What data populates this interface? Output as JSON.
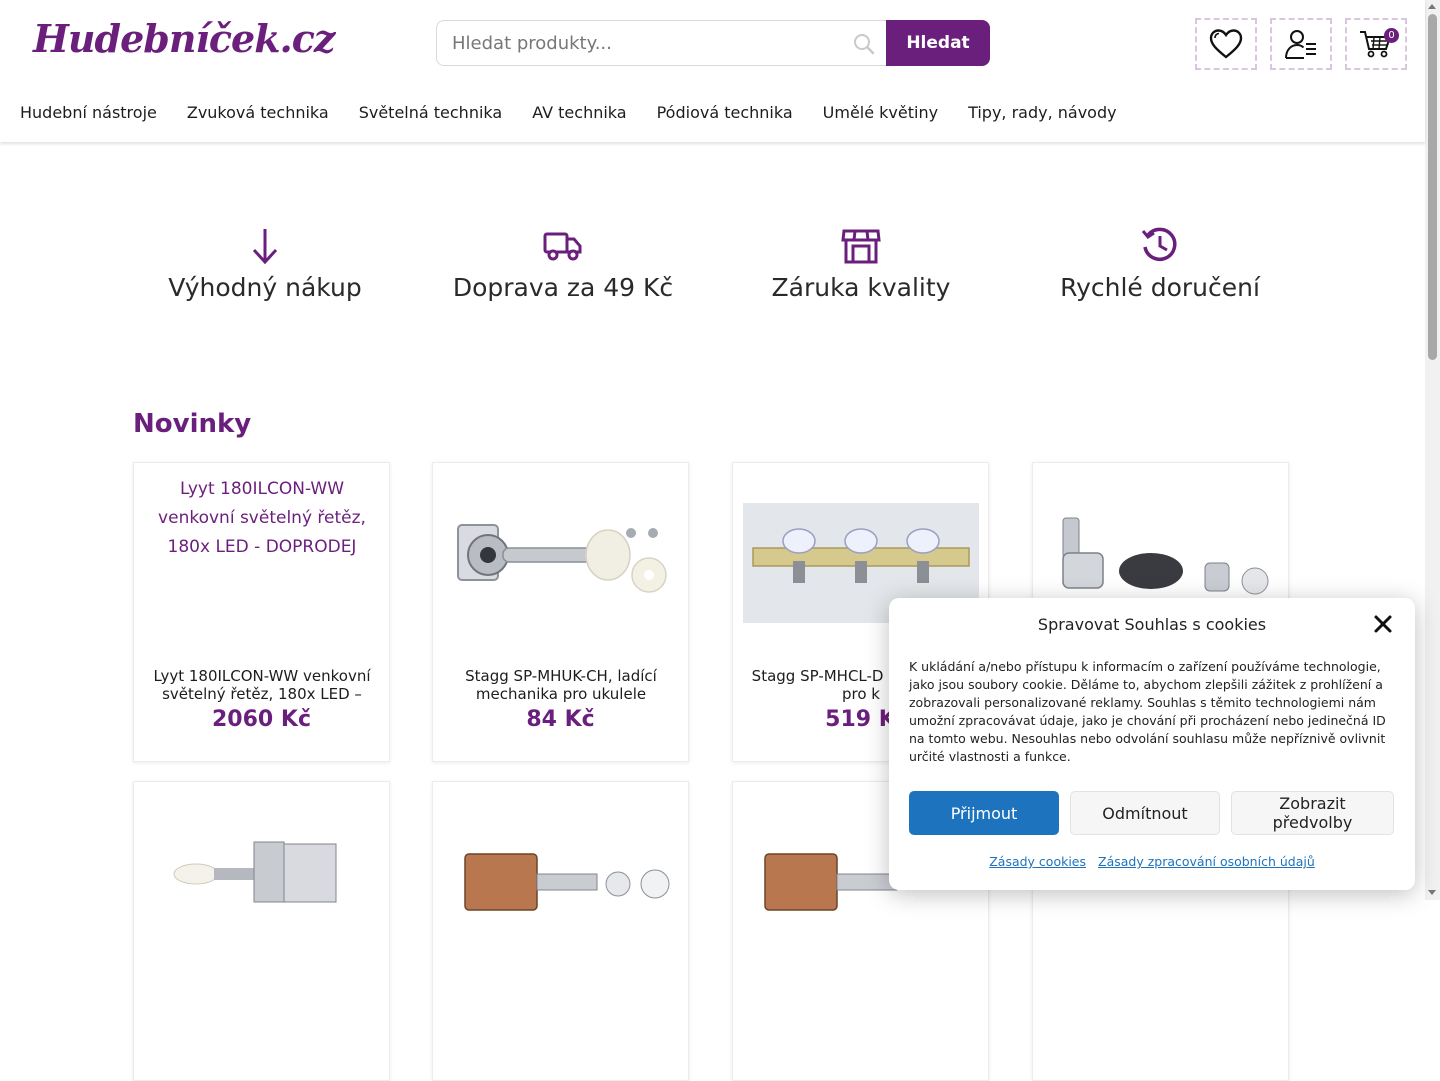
{
  "brand": {
    "logo_text": "Hudebníček.cz",
    "accent": "#6b1f7c"
  },
  "search": {
    "placeholder": "Hledat produkty...",
    "value": "",
    "button_label": "Hledat"
  },
  "header_icons": {
    "wishlist_icon": "heart-icon",
    "account_icon": "user-list-icon",
    "cart_icon": "cart-icon",
    "cart_count": "0"
  },
  "nav": {
    "items": [
      {
        "label": "Hudební nástroje"
      },
      {
        "label": "Zvuková technika"
      },
      {
        "label": "Světelná technika"
      },
      {
        "label": "AV technika"
      },
      {
        "label": "Pódiová technika"
      },
      {
        "label": "Umělé květiny"
      },
      {
        "label": "Tipy, rady, návody"
      }
    ]
  },
  "features": [
    {
      "icon": "arrow-down-icon",
      "label": "Výhodný nákup"
    },
    {
      "icon": "truck-icon",
      "label": "Doprava za 49 Kč"
    },
    {
      "icon": "store-icon",
      "label": "Záruka kvality"
    },
    {
      "icon": "history-icon",
      "label": "Rychlé doručení"
    }
  ],
  "section": {
    "title": "Novinky"
  },
  "products": [
    {
      "image_alt": "Lyyt 180ILCON-WW venkovní světelný řetěz, 180x LED - DOPRODEJ",
      "name": "Lyyt 180ILCON-WW venkovní světelný řetěz, 180x LED –",
      "price": "2060 Kč"
    },
    {
      "name": "Stagg SP-MHUK-CH, ladící mechanika pro ukulele",
      "price": "84 Kč"
    },
    {
      "name": "Stagg SP-MHCL-D mechanika pro k",
      "price": "519 K"
    },
    {
      "name": "",
      "price": ""
    }
  ],
  "cookie": {
    "title": "Spravovat Souhlas s cookies",
    "text": "K ukládání a/nebo přístupu k informacím o zařízení používáme technologie, jako jsou soubory cookie. Děláme to, abychom zlepšili zážitek z prohlížení a zobrazovali personalizované reklamy. Souhlas s těmito technologiemi nám umožní zpracovávat údaje, jako je chování při procházení nebo jedinečná ID na tomto webu. Nesouhlas nebo odvolání souhlasu může nepříznivě ovlivnit určité vlastnosti a funkce.",
    "accept_label": "Přijmout",
    "deny_label": "Odmítnout",
    "prefs_label": "Zobrazit předvolby",
    "link_cookies": "Zásady cookies",
    "link_privacy": "Zásady zpracování osobních údajů",
    "accept_color": "#1e73be"
  }
}
